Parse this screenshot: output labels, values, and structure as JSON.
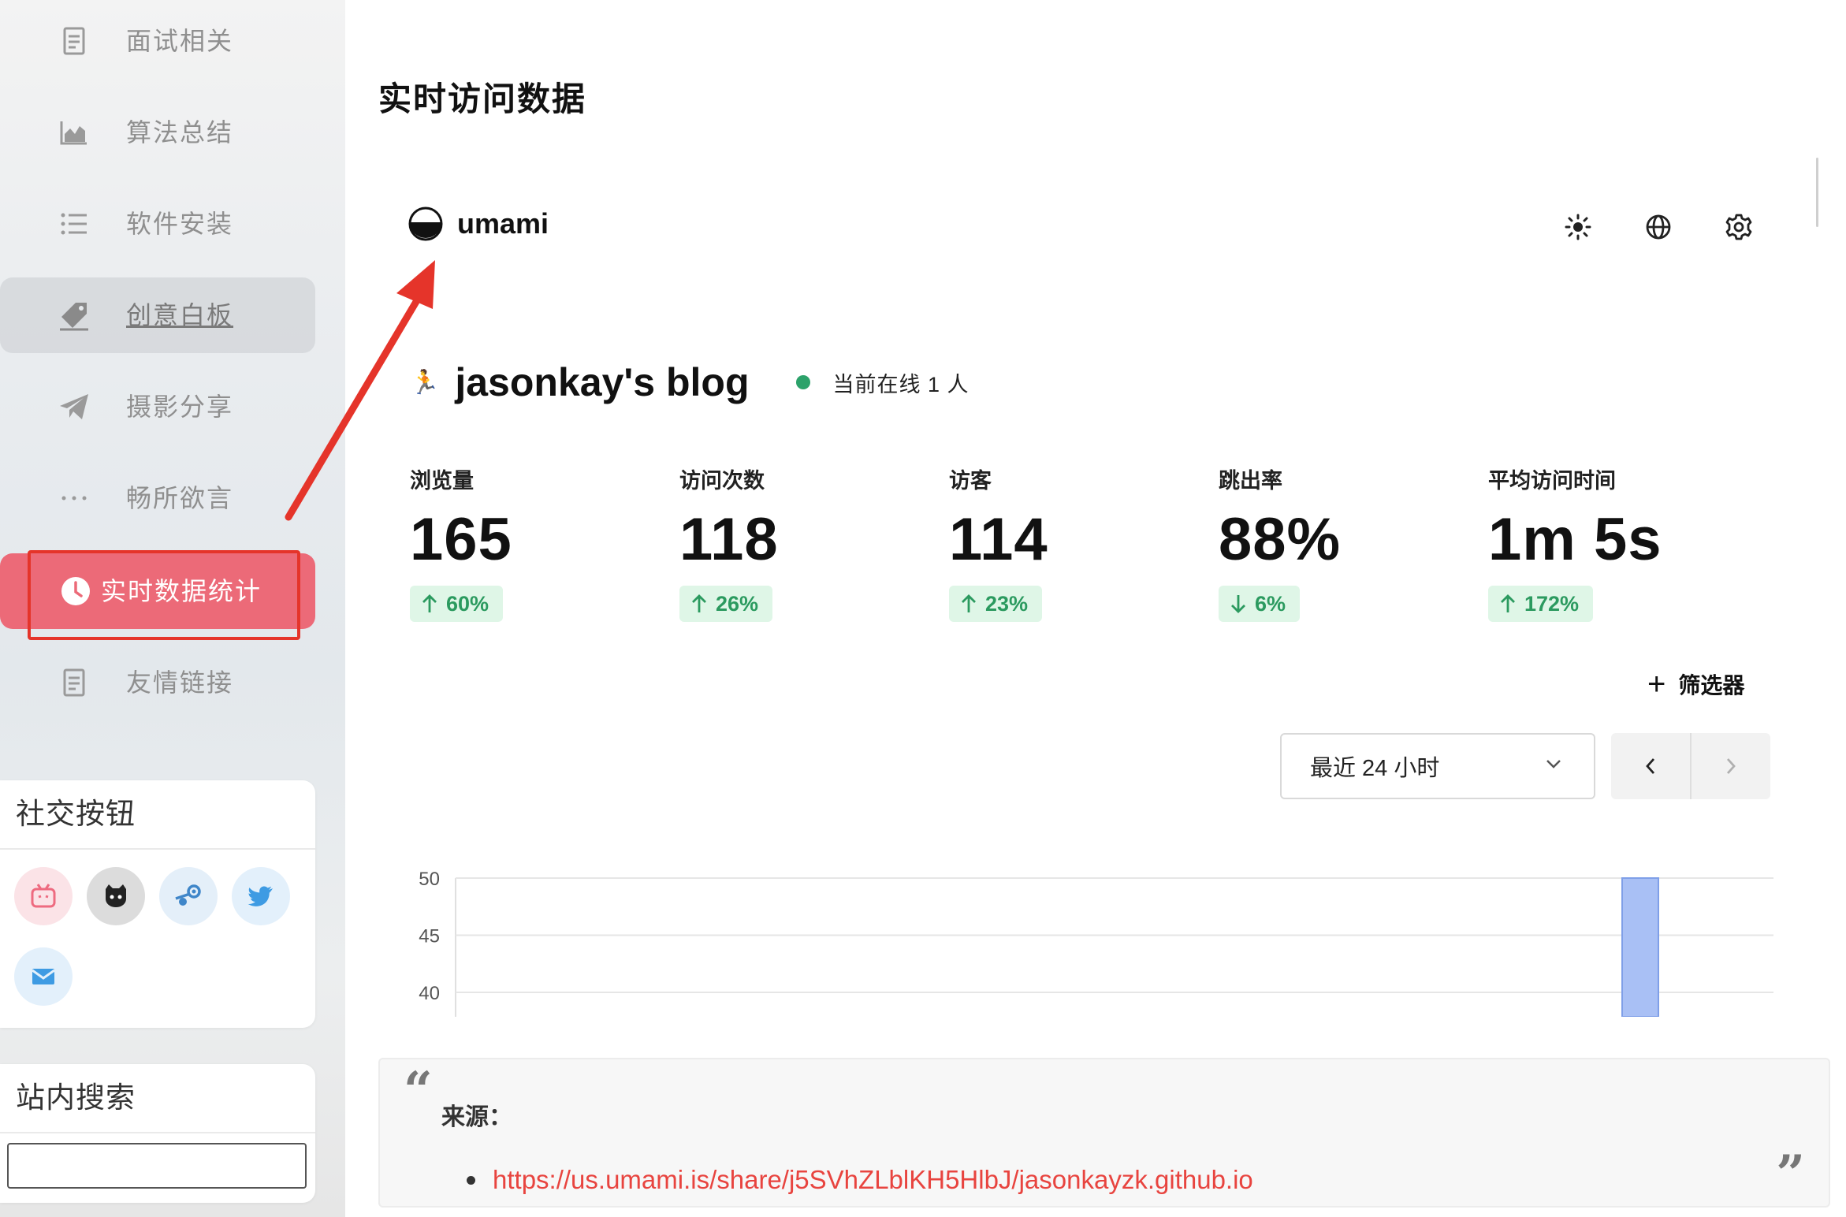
{
  "sidebar": {
    "menu": [
      {
        "label": "面试相关",
        "icon": "document-icon"
      },
      {
        "label": "算法总结",
        "icon": "chart-area-icon"
      },
      {
        "label": "软件安装",
        "icon": "list-icon"
      },
      {
        "label": "创意白板",
        "icon": "tag-icon"
      },
      {
        "label": "摄影分享",
        "icon": "paper-plane-icon"
      },
      {
        "label": "畅所欲言",
        "icon": "more-dots-icon"
      },
      {
        "label": "实时数据统计",
        "icon": "clock-icon"
      },
      {
        "label": "友情链接",
        "icon": "document-icon"
      }
    ],
    "social": {
      "title": "社交按钮",
      "buttons": [
        "bilibili-icon",
        "github-icon",
        "steam-icon",
        "twitter-icon",
        "mail-icon"
      ]
    },
    "search": {
      "title": "站内搜索",
      "value": "",
      "placeholder": ""
    }
  },
  "main": {
    "page_title": "实时访问数据",
    "brand": {
      "name": "umami"
    },
    "top_icons": [
      "theme-sun-icon",
      "language-globe-icon",
      "settings-gear-icon"
    ],
    "site": {
      "emoji": "🏃",
      "name": "jasonkay's blog",
      "online": "当前在线 1 人"
    },
    "stats": [
      {
        "label": "浏览量",
        "value": "165",
        "change": "60%",
        "direction": "up"
      },
      {
        "label": "访问次数",
        "value": "118",
        "change": "26%",
        "direction": "up"
      },
      {
        "label": "访客",
        "value": "114",
        "change": "23%",
        "direction": "up"
      },
      {
        "label": "跳出率",
        "value": "88%",
        "change": "6%",
        "direction": "down"
      },
      {
        "label": "平均访问时间",
        "value": "1m 5s",
        "change": "172%",
        "direction": "up"
      }
    ],
    "filter_label": "筛选器",
    "range_select": {
      "value": "最近 24 小时"
    },
    "quote": {
      "label": "来源：",
      "link": "https://us.umami.is/share/j5SVhZLblKH5HlbJ/jasonkayzk.github.io"
    }
  },
  "chart_data": {
    "type": "bar",
    "y_ticks": [
      "50",
      "45",
      "40"
    ],
    "ylim": [
      38,
      50
    ],
    "visible_bars": [
      {
        "position": "near right end",
        "value": 50
      }
    ],
    "bar_color": "#a9c0f5",
    "grid": true
  },
  "colors": {
    "accent_active": "#ec6a78",
    "badge_bg": "#dff6e7",
    "badge_text": "#2b9a5f",
    "online_dot": "#2ca26a",
    "link": "#e8443f",
    "annotation_red": "#e5342a"
  }
}
